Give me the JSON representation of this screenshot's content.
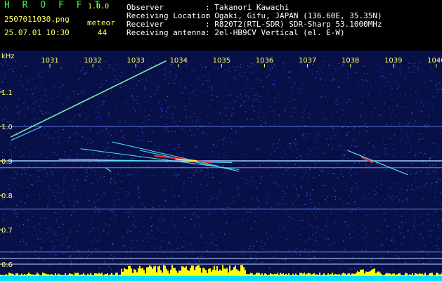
{
  "header": {
    "logo": "H R O F F T",
    "version": "1.0.0",
    "filename": "2507011030.png",
    "meteor_label": "meteor",
    "datetime": "25.07.01 10:30",
    "meteor_count": "44",
    "fields": [
      {
        "label": "Observer",
        "value": ": Takanori Kawachi"
      },
      {
        "label": "Receiving Location",
        "value": ": Ogaki, Gifu, JAPAN (136.60E, 35.35N)"
      },
      {
        "label": "Receiver",
        "value": ": R820T2(RTL-SDR) SDR-Sharp 53.1000MHz"
      },
      {
        "label": "Receiving antenna",
        "value": ": 2el-HB9CV Vertical (el. E-W)"
      }
    ]
  },
  "chart_data": {
    "type": "scatter",
    "title": "",
    "ylabel": "kHz",
    "x_ticks": [
      "1031",
      "1032",
      "1033",
      "1034",
      "1035",
      "1036",
      "1037",
      "1038",
      "1039",
      "1040"
    ],
    "y_ticks": [
      "1.1",
      "1.0",
      "0.9",
      "0.8",
      "0.7",
      "0.6"
    ],
    "ylim": [
      0.58,
      1.18
    ],
    "background_color": "#081048",
    "carrier_frequency_khz": 0.9,
    "colors": {
      "axis_text": "#ffff66",
      "trace": "#55ddff",
      "hot": "#ff3030",
      "level_bar": "#ffff00",
      "level_base": "#00e0ff"
    }
  }
}
